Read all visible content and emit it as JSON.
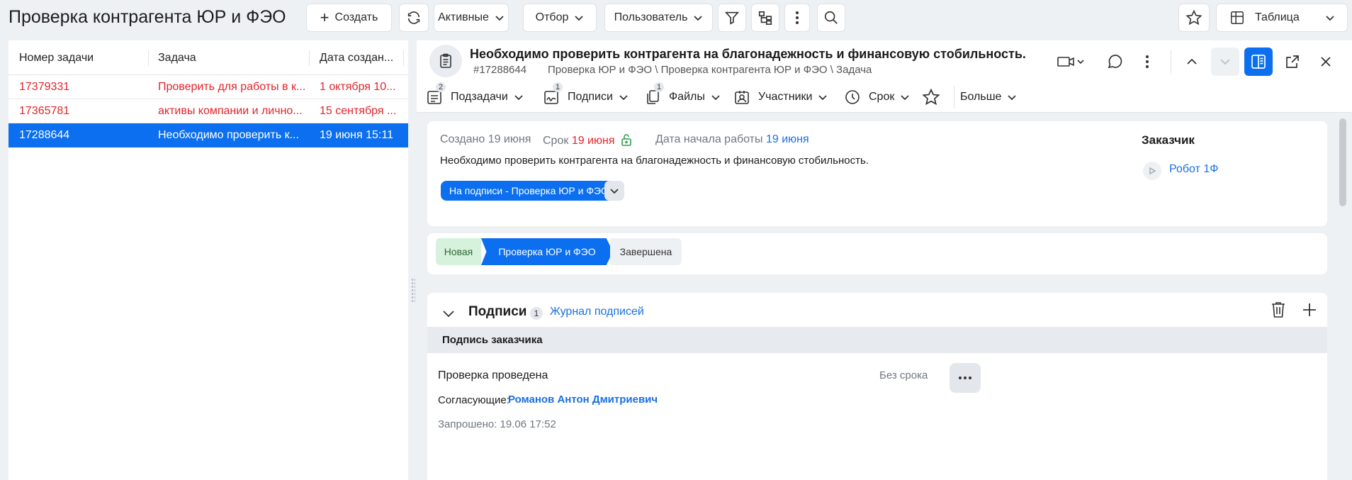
{
  "topbar": {
    "title": "Проверка контрагента ЮР и ФЭО",
    "create_label": "Создать",
    "filter_active_label": "Активные",
    "filter_selection_label": "Отбор",
    "filter_user_label": "Пользователь",
    "view_label": "Таблица"
  },
  "list": {
    "columns": [
      "Номер задачи",
      "Задача",
      "Дата создан..."
    ],
    "rows": [
      {
        "number": "17379331",
        "task": "Проверить для работы в к...",
        "date": "1 октября 10...",
        "style": "red"
      },
      {
        "number": "17365781",
        "task": "активы компании и лично...",
        "date": "15 сентября ...",
        "style": "red"
      },
      {
        "number": "17288644",
        "task": "Необходимо проверить к...",
        "date": "19 июня 15:11",
        "style": "selected"
      }
    ]
  },
  "task": {
    "title": "Необходимо проверить контрагента на благонадежность и финансовую стобильность.",
    "number": "#17288644",
    "path": "Проверка ЮР и ФЭО \\ Проверка контрагента ЮР и ФЭО \\ Задача",
    "description": "Необходимо проверить контрагента на благонадежность и финансовую стобильность."
  },
  "tabs": [
    {
      "label": "Подзадачи",
      "badge": "2",
      "icon": "subtasks-icon"
    },
    {
      "label": "Подписи",
      "badge": "1",
      "icon": "signature-icon"
    },
    {
      "label": "Файлы",
      "badge": "1",
      "icon": "files-icon"
    },
    {
      "label": "Участники",
      "badge": "",
      "icon": "participants-icon"
    },
    {
      "label": "Срок",
      "badge": "",
      "icon": "clock-icon"
    },
    {
      "label": "",
      "badge": "",
      "icon": "star-icon"
    },
    {
      "label": "Больше",
      "badge": "",
      "icon": ""
    }
  ],
  "meta": {
    "created_label": "Создано",
    "created_value": "19 июня",
    "deadline_label": "Срок",
    "deadline_value": "19 июня",
    "start_label": "Дата начала работы",
    "start_value": "19 июня",
    "customer_label": "Заказчик",
    "customer_name": "Робот 1Ф",
    "status": "На подписи - Проверка ЮР и ФЭО"
  },
  "stages": [
    "Новая",
    "Проверка ЮР и ФЭО",
    "Завершена"
  ],
  "signatures": {
    "section_title": "Подписи",
    "count": "1",
    "journal_link": "Журнал подписей",
    "group_title": "Подпись заказчика",
    "item_title": "Проверка проведена",
    "deadline": "Без срока",
    "approvers_label": "Согласующие:",
    "approver_name": "Романов Антон Дмитриевич",
    "requested": "Запрошено: 19.06 17:52"
  },
  "colors": {
    "accent": "#0b6ff0",
    "overdue": "#e3242b",
    "link": "#1a6fe0",
    "stage_done": "#d7f2dc"
  }
}
